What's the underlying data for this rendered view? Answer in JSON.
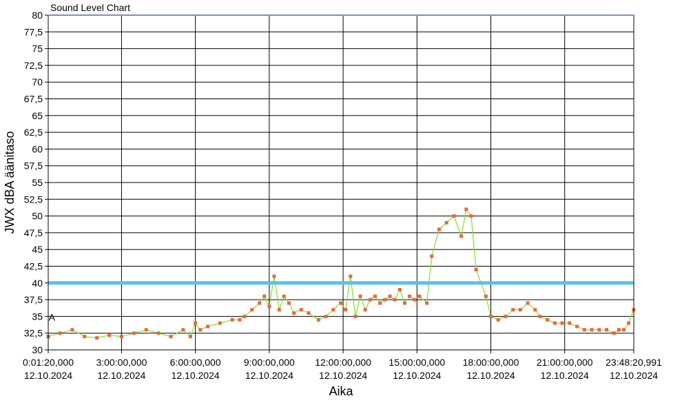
{
  "chart_data": {
    "type": "line",
    "title": "Sound Level Chart",
    "xlabel": "Aika",
    "ylabel": "JWX dBA äänitaso",
    "ylim": [
      30,
      80
    ],
    "y_ticks": [
      "30",
      "32,5",
      "35",
      "37,5",
      "40",
      "42,5",
      "45",
      "47,5",
      "50",
      "52,5",
      "55",
      "57,5",
      "60",
      "62,5",
      "65",
      "67,5",
      "70",
      "72,5",
      "75",
      "77,5",
      "80"
    ],
    "x_ticks": [
      {
        "time": "0:01:20,000",
        "date": "12.10.2024"
      },
      {
        "time": "3:00:00,000",
        "date": "12.10.2024"
      },
      {
        "time": "6:00:00,000",
        "date": "12.10.2024"
      },
      {
        "time": "9:00:00,000",
        "date": "12.10.2024"
      },
      {
        "time": "12:00:00,000",
        "date": "12.10.2024"
      },
      {
        "time": "15:00:00,000",
        "date": "12.10.2024"
      },
      {
        "time": "18:00:00,000",
        "date": "12.10.2024"
      },
      {
        "time": "21:00:00,000",
        "date": "12.10.2024"
      },
      {
        "time": "23:48:20,991",
        "date": "12.10.2024"
      }
    ],
    "x_tick_hours": [
      0.0222,
      3,
      6,
      9,
      12,
      15,
      18,
      21,
      23.8058
    ],
    "xlim_hours": [
      0.0222,
      23.8058
    ],
    "grid": true,
    "threshold": {
      "value": 40,
      "color": "#5bc0eb"
    },
    "annotation": {
      "text": "A",
      "x_hours": 0.15,
      "y": 35
    },
    "series": [
      {
        "line_color": "#7fe030",
        "marker_color": "#e8683a",
        "x_hours": [
          0.0,
          0.5,
          1.0,
          1.5,
          2.0,
          2.5,
          3.0,
          3.5,
          4.0,
          4.5,
          5.0,
          5.5,
          5.8,
          6.0,
          6.2,
          6.5,
          7.0,
          7.5,
          7.8,
          8.0,
          8.3,
          8.6,
          8.8,
          9.0,
          9.2,
          9.4,
          9.6,
          9.8,
          10.0,
          10.3,
          10.6,
          11.0,
          11.3,
          11.6,
          11.9,
          12.1,
          12.3,
          12.5,
          12.7,
          12.9,
          13.1,
          13.3,
          13.5,
          13.7,
          13.9,
          14.1,
          14.3,
          14.5,
          14.7,
          14.9,
          15.1,
          15.4,
          15.6,
          15.9,
          16.2,
          16.5,
          16.8,
          17.0,
          17.2,
          17.4,
          17.6,
          17.8,
          18.0,
          18.3,
          18.6,
          18.9,
          19.2,
          19.5,
          19.8,
          20.0,
          20.3,
          20.6,
          20.9,
          21.2,
          21.5,
          21.8,
          22.1,
          22.4,
          22.7,
          23.0,
          23.2,
          23.4,
          23.6,
          23.8
        ],
        "values": [
          32.0,
          32.5,
          33.0,
          32.0,
          31.8,
          32.2,
          32.0,
          32.5,
          33.0,
          32.5,
          32.0,
          33.0,
          32.0,
          34.0,
          33.0,
          33.5,
          34.0,
          34.5,
          34.5,
          35.0,
          36.0,
          37.0,
          38.0,
          36.5,
          41.0,
          36.0,
          38.0,
          37.0,
          35.5,
          36.0,
          35.5,
          34.5,
          35.0,
          36.0,
          37.0,
          36.0,
          41.0,
          35.0,
          38.0,
          36.0,
          37.5,
          38.0,
          37.0,
          37.5,
          38.0,
          37.5,
          39.0,
          37.0,
          38.0,
          37.5,
          38.0,
          37.0,
          44.0,
          48.0,
          49.0,
          50.0,
          47.0,
          51.0,
          50.0,
          42.0,
          40.0,
          38.0,
          35.0,
          34.5,
          35.0,
          36.0,
          36.0,
          37.0,
          36.0,
          35.0,
          34.5,
          34.0,
          34.0,
          34.0,
          33.5,
          33.0,
          33.0,
          33.0,
          33.0,
          32.5,
          33.0,
          33.0,
          34.0,
          36.0
        ]
      }
    ]
  }
}
